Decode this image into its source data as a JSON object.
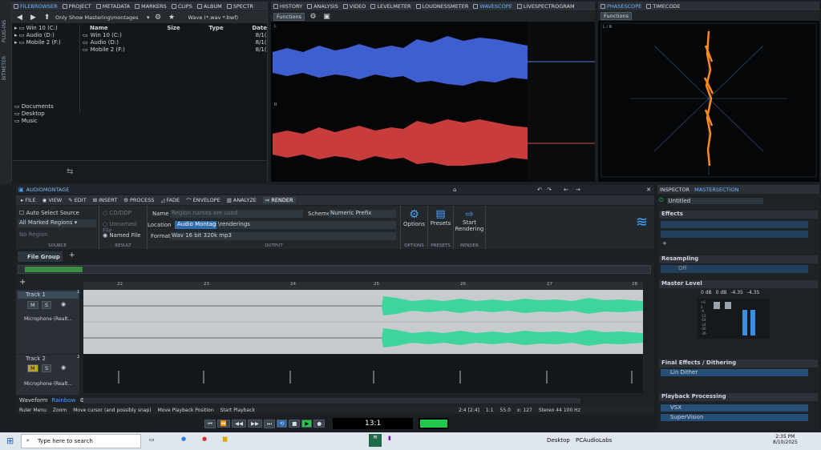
{
  "top_tabs_left": [
    "FILEBROWSER",
    "PROJECT",
    "METADATA",
    "MARKERS",
    "CLIPS",
    "ALBUM",
    "SPECTR"
  ],
  "top_tabs_mid": [
    "HISTORY",
    "ANALYSIS",
    "VIDEO",
    "LEVELMETER",
    "LOUDNESSMETER",
    "WAVESCOPE",
    "LIVESPECTROGRAM"
  ],
  "top_tabs_right": [
    "PHASESCOPE",
    "TIMECODE"
  ],
  "side_labels": [
    "PLUG-INS",
    "BITMETER"
  ],
  "browser": {
    "filter": "Only Show Mastering\\montages",
    "file_type": "Wave (*.wav *.bwf)",
    "tree": [
      "Win 10 (C:)",
      "Audio (D:)",
      "Mobile 2 (F:)"
    ],
    "columns": [
      "Name",
      "Size",
      "Type",
      "Date"
    ],
    "rows": [
      "Win 10 (C:)",
      "Audio (D:)",
      "Mobile 2 (F:)"
    ],
    "dates": [
      "8/1(",
      "8/1(",
      "8/1("
    ],
    "favorites": [
      "Documents",
      "Desktop",
      "Music"
    ]
  },
  "wavescope": {
    "functions": "Functions",
    "ch1": "L",
    "ch2": "R"
  },
  "phasescope": {
    "functions": "Functions",
    "scale": "L / R"
  },
  "montage": {
    "title": "AUDIOMONTAGE",
    "menu": [
      "FILE",
      "VIEW",
      "EDIT",
      "INSERT",
      "PROCESS",
      "FADE",
      "ENVELOPE",
      "ANALYZE",
      "RENDER"
    ],
    "source": {
      "auto": "Auto Select Source",
      "regions": "All Marked Regions",
      "noregion": "No Region",
      "label": "SOURCE"
    },
    "result": {
      "cdddp": "CD/DDP",
      "unnamed": "Unnamed File",
      "named": "Named File",
      "label": "RESULT"
    },
    "output": {
      "name_label": "Name",
      "name_placeholder": "Region names are used",
      "scheme_label": "Scheme",
      "scheme": "Numeric Prefix",
      "location_label": "Location",
      "location_tag": "Audio Montage",
      "location": "\\renderings",
      "format_label": "Format",
      "format": "Wav 16 bit 320k mp3",
      "label": "OUTPUT"
    },
    "options": "Options",
    "options_label": "OPTIONS",
    "presets": "Presets",
    "presets_label": "PRESETS",
    "start": "Start",
    "rendering": "Rendering",
    "render_label": "RENDER",
    "file_group": "File Group",
    "ruler": [
      "22",
      "23",
      "24",
      "25",
      "26",
      "27",
      "28"
    ],
    "tracks": [
      {
        "name": "Track 1",
        "plugin": "Microphone (Realt...",
        "num": "1"
      },
      {
        "name": "Track 2",
        "plugin": "Microphone (Realt...",
        "num": "2"
      }
    ],
    "mute": "M",
    "solo": "S",
    "view_mode": "Waveform",
    "view_color": "Rainbow",
    "status": [
      "Ruler Menu",
      "Zoom",
      "Move cursor (and possibly snap)",
      "Move Playback Position",
      "Start Playback"
    ],
    "status_right": [
      "2:4 [2:4]",
      "1:1",
      "55.0",
      "x: 127",
      "Stereo 44 100 Hz"
    ]
  },
  "transport": {
    "time": "13:1"
  },
  "inspector": {
    "tabs": [
      "INSPECTOR",
      "MASTERSECTION"
    ],
    "preset": "Untitled",
    "effects": "Effects",
    "resampling": "Resampling",
    "resampling_val": "Off",
    "master_level": "Master Level",
    "levels": [
      "0 dB",
      "0 dB",
      "-4.35",
      "-4.35"
    ],
    "scale": [
      "+6",
      "0",
      "-6",
      "-12",
      "-18",
      "-24",
      "-30",
      "-36"
    ],
    "final": "Final Effects / Dithering",
    "lin_dither": "Lin Dither",
    "playback": "Playback Processing",
    "vsx": "VSX",
    "supervision": "SuperVision"
  },
  "taskbar": {
    "search": "Type here to search",
    "desktop": "Desktop",
    "app": "PCAudioLabs",
    "time": "2:35 PM",
    "date": "8/10/2025"
  },
  "colors": {
    "accent": "#4aa3ff",
    "wave_l": "#3f5ecf",
    "wave_r": "#c83c3c",
    "montage_wave": "#3dd59b",
    "green": "#22c84a"
  }
}
